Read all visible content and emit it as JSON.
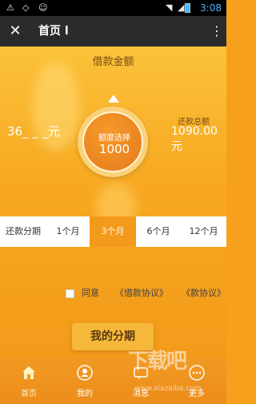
{
  "status_bar": {
    "time": "3:08"
  },
  "titlebar": {
    "title": "首页 l"
  },
  "loan": {
    "label": "借款金额",
    "left_amount": "36_ _ _元",
    "total_label": "还款总额",
    "total_amount": "1090.00元",
    "dial_label": "额度选择",
    "dial_value": "1000"
  },
  "period": {
    "label": "还款分期",
    "options": [
      "1个月",
      "3个月",
      "6个月",
      "12个月"
    ],
    "selected": "3个月"
  },
  "agreement": {
    "agree_text": "同意",
    "link1": "《借款协议》",
    "link2": "《款协议》"
  },
  "apply_button": "我的分期",
  "bottom_nav": {
    "items": [
      {
        "label": "首页",
        "icon": "home-icon"
      },
      {
        "label": "我的",
        "icon": "user-icon"
      },
      {
        "label": "消息",
        "icon": "message-icon"
      },
      {
        "label": "更多",
        "icon": "more-icon"
      }
    ],
    "active": "首页"
  },
  "watermark": {
    "text": "下载吧",
    "sub": "www.xiazaiba.com"
  },
  "colors": {
    "accent": "#f39a1a",
    "titlebar": "#2b2b2b",
    "time": "#4fb3ff"
  }
}
